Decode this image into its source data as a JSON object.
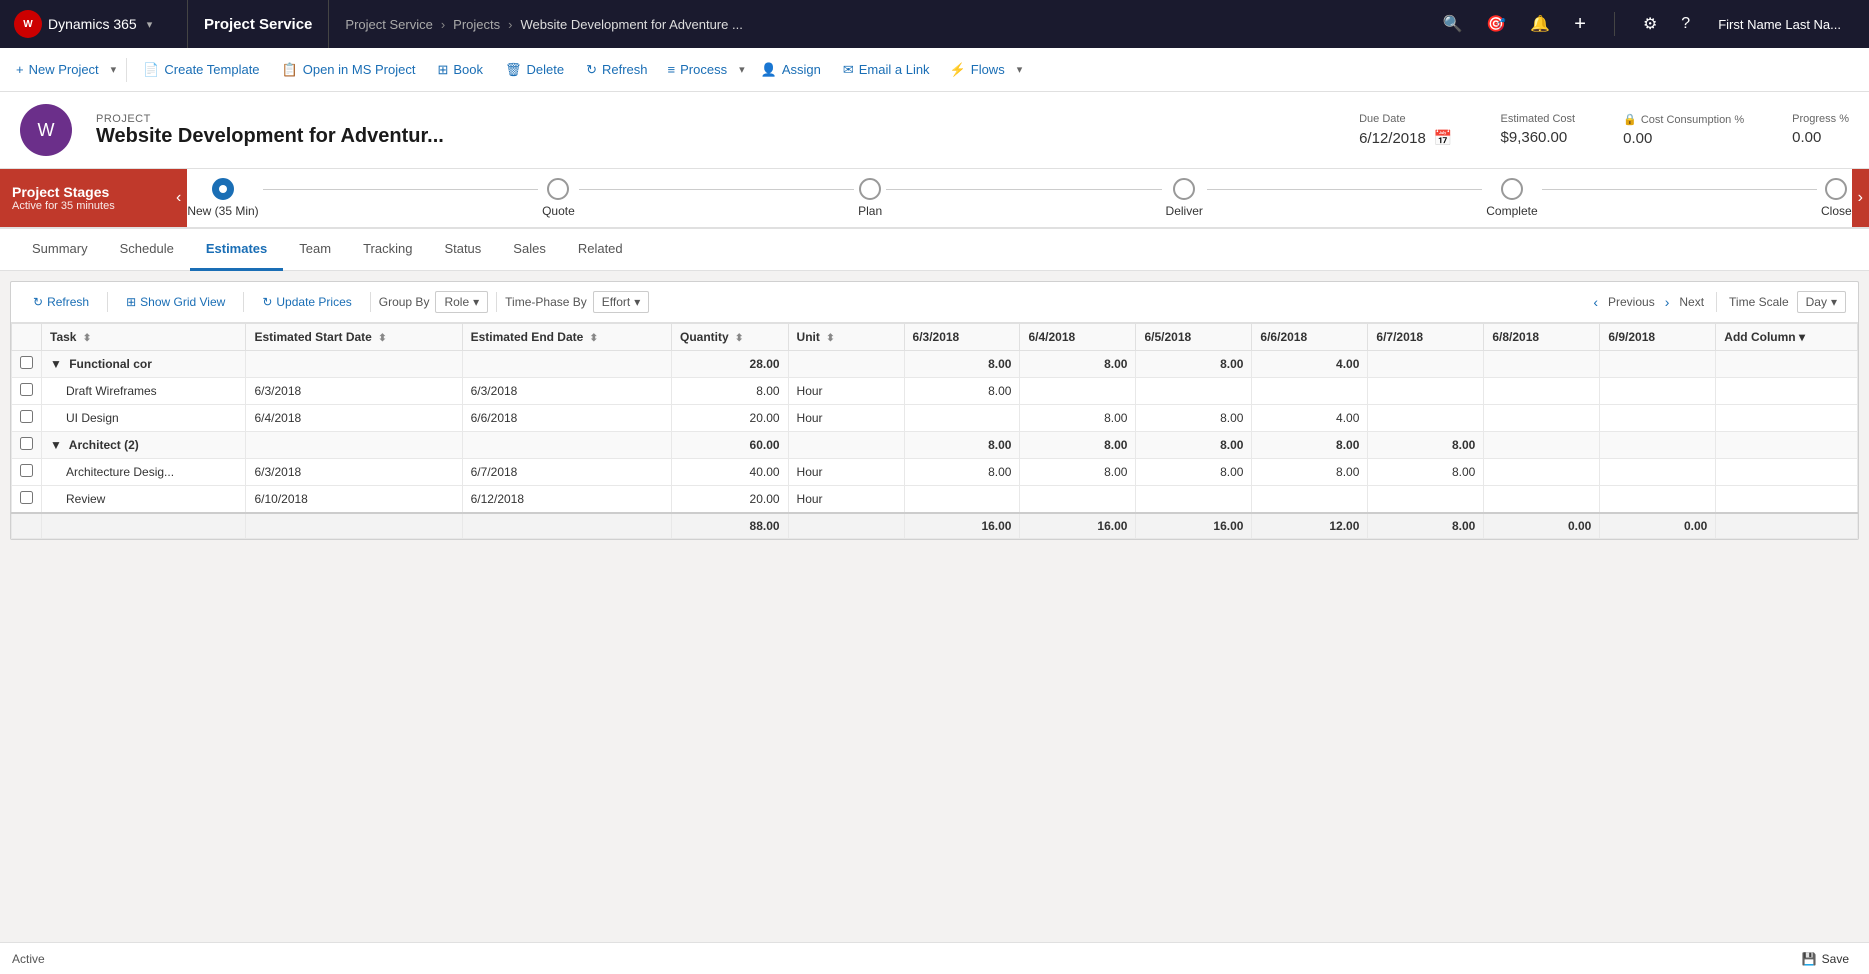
{
  "topNav": {
    "brand": "Dynamics 365",
    "brandChevron": "▾",
    "module": "Project Service",
    "breadcrumbs": [
      "Project Service",
      "Projects",
      "Website Development for Adventure ..."
    ],
    "icons": [
      "search",
      "target",
      "bell",
      "plus"
    ],
    "settingsIcon": "⚙",
    "helpIcon": "?",
    "user": "First Name Last Na..."
  },
  "commandBar": {
    "buttons": [
      {
        "id": "new-project",
        "icon": "+",
        "label": "New Project",
        "hasSplit": true
      },
      {
        "id": "create-template",
        "icon": "📄",
        "label": "Create Template"
      },
      {
        "id": "open-ms-project",
        "icon": "📋",
        "label": "Open in MS Project"
      },
      {
        "id": "book",
        "icon": "⊞",
        "label": "Book"
      },
      {
        "id": "delete",
        "icon": "🗑",
        "label": "Delete"
      },
      {
        "id": "refresh",
        "icon": "↻",
        "label": "Refresh"
      },
      {
        "id": "process",
        "icon": "≡",
        "label": "Process",
        "hasSplit": true
      },
      {
        "id": "assign",
        "icon": "👤",
        "label": "Assign"
      },
      {
        "id": "email-link",
        "icon": "✉",
        "label": "Email a Link"
      },
      {
        "id": "flows",
        "icon": "⚡",
        "label": "Flows",
        "hasSplit": true
      }
    ]
  },
  "project": {
    "label": "PROJECT",
    "name": "Website Development for Adventur...",
    "iconChar": "W",
    "dueDate": {
      "label": "Due Date",
      "value": "6/12/2018",
      "calendarIcon": "📅"
    },
    "estimatedCost": {
      "label": "Estimated Cost",
      "value": "$9,360.00"
    },
    "costConsumption": {
      "label": "Cost Consumption %",
      "value": "0.00",
      "lockIcon": "🔒"
    },
    "progress": {
      "label": "Progress %",
      "value": "0.00"
    }
  },
  "stages": {
    "sectionLabel": "Project Stages",
    "sectionSubtitle": "Active for 35 minutes",
    "leftArrow": "‹",
    "rightArrow": "›",
    "steps": [
      {
        "id": "new",
        "label": "New  (35 Min)",
        "active": true
      },
      {
        "id": "quote",
        "label": "Quote",
        "active": false
      },
      {
        "id": "plan",
        "label": "Plan",
        "active": false
      },
      {
        "id": "deliver",
        "label": "Deliver",
        "active": false
      },
      {
        "id": "complete",
        "label": "Complete",
        "active": false
      },
      {
        "id": "close",
        "label": "Close",
        "active": false
      }
    ]
  },
  "tabs": {
    "items": [
      {
        "id": "summary",
        "label": "Summary",
        "active": false
      },
      {
        "id": "schedule",
        "label": "Schedule",
        "active": false
      },
      {
        "id": "estimates",
        "label": "Estimates",
        "active": true
      },
      {
        "id": "team",
        "label": "Team",
        "active": false
      },
      {
        "id": "tracking",
        "label": "Tracking",
        "active": false
      },
      {
        "id": "status",
        "label": "Status",
        "active": false
      },
      {
        "id": "sales",
        "label": "Sales",
        "active": false
      },
      {
        "id": "related",
        "label": "Related",
        "active": false
      }
    ]
  },
  "estimatesToolbar": {
    "refreshLabel": "Refresh",
    "showGridLabel": "Show Grid View",
    "updatePricesLabel": "Update Prices",
    "groupByLabel": "Group By",
    "groupByValue": "Role",
    "timePhaseByLabel": "Time-Phase By",
    "timePhaseByValue": "Effort",
    "previousLabel": "Previous",
    "nextLabel": "Next",
    "timeScaleLabel": "Time Scale",
    "timeScaleValue": "Day"
  },
  "tableColumns": {
    "checkbox": "",
    "task": "Task",
    "startDate": "Estimated Start Date",
    "endDate": "Estimated End Date",
    "quantity": "Quantity",
    "unit": "Unit",
    "dates": [
      "6/3/2018",
      "6/4/2018",
      "6/5/2018",
      "6/6/2018",
      "6/7/2018",
      "6/8/2018",
      "6/9/2018"
    ],
    "addColumn": "Add Column"
  },
  "tableData": {
    "groups": [
      {
        "id": "functional",
        "label": "Functional cor",
        "quantity": "28.00",
        "unit": "",
        "dates": [
          "8.00",
          "8.00",
          "8.00",
          "4.00",
          "",
          "",
          ""
        ],
        "expanded": true,
        "rows": [
          {
            "task": "Draft Wireframes",
            "startDate": "6/3/2018",
            "endDate": "6/3/2018",
            "quantity": "8.00",
            "unit": "Hour",
            "dates": [
              "8.00",
              "",
              "",
              "",
              "",
              "",
              ""
            ]
          },
          {
            "task": "UI Design",
            "startDate": "6/4/2018",
            "endDate": "6/6/2018",
            "quantity": "20.00",
            "unit": "Hour",
            "dates": [
              "",
              "8.00",
              "8.00",
              "4.00",
              "",
              "",
              ""
            ]
          }
        ]
      },
      {
        "id": "architect",
        "label": "Architect (2)",
        "quantity": "60.00",
        "unit": "",
        "dates": [
          "8.00",
          "8.00",
          "8.00",
          "8.00",
          "8.00",
          "",
          ""
        ],
        "expanded": true,
        "rows": [
          {
            "task": "Architecture Desig...",
            "startDate": "6/3/2018",
            "endDate": "6/7/2018",
            "quantity": "40.00",
            "unit": "Hour",
            "dates": [
              "8.00",
              "8.00",
              "8.00",
              "8.00",
              "8.00",
              "",
              ""
            ]
          },
          {
            "task": "Review",
            "startDate": "6/10/2018",
            "endDate": "6/12/2018",
            "quantity": "20.00",
            "unit": "Hour",
            "dates": [
              "",
              "",
              "",
              "",
              "",
              "",
              ""
            ]
          }
        ]
      }
    ],
    "footer": {
      "quantity": "88.00",
      "dates": [
        "16.00",
        "16.00",
        "16.00",
        "12.00",
        "8.00",
        "0.00",
        "0.00"
      ]
    }
  },
  "statusBar": {
    "status": "Active",
    "saveLabel": "Save",
    "saveIcon": "💾"
  }
}
